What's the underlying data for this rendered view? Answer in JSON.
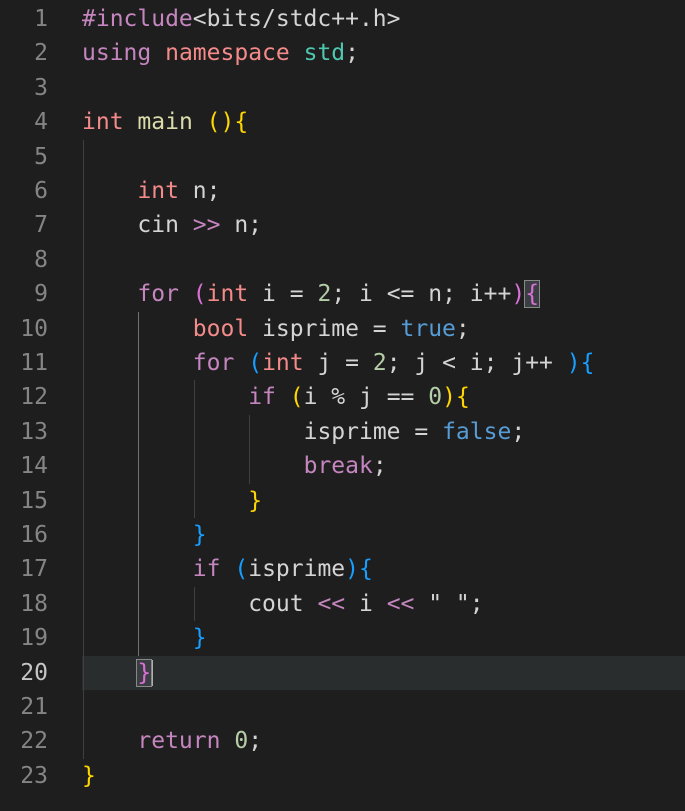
{
  "editor": {
    "current_line": 20,
    "lines": [
      {
        "n": "1",
        "indent": 0,
        "tokens": [
          [
            "t-inc",
            "#include"
          ],
          [
            "t-hdr",
            "<bits/stdc++.h>"
          ]
        ]
      },
      {
        "n": "2",
        "indent": 0,
        "tokens": [
          [
            "t-kw",
            "using"
          ],
          [
            "t-plain",
            " "
          ],
          [
            "t-type",
            "namespace"
          ],
          [
            "t-plain",
            " "
          ],
          [
            "t-ns",
            "std"
          ],
          [
            "t-plain",
            ";"
          ]
        ]
      },
      {
        "n": "3",
        "indent": 0,
        "tokens": []
      },
      {
        "n": "4",
        "indent": 0,
        "tokens": [
          [
            "t-type",
            "int"
          ],
          [
            "t-plain",
            " "
          ],
          [
            "t-fn",
            "main"
          ],
          [
            "t-plain",
            " "
          ],
          [
            "t-b1",
            "()"
          ],
          [
            "t-b1",
            "{"
          ]
        ]
      },
      {
        "n": "5",
        "indent": 0,
        "tokens": []
      },
      {
        "n": "6",
        "indent": 1,
        "tokens": [
          [
            "t-type",
            "int"
          ],
          [
            "t-plain",
            " n;"
          ]
        ]
      },
      {
        "n": "7",
        "indent": 1,
        "tokens": [
          [
            "t-plain",
            "cin "
          ],
          [
            "t-kw",
            ">>"
          ],
          [
            "t-plain",
            " n;"
          ]
        ]
      },
      {
        "n": "8",
        "indent": 0,
        "tokens": []
      },
      {
        "n": "9",
        "indent": 1,
        "tokens": [
          [
            "t-kw",
            "for"
          ],
          [
            "t-plain",
            " "
          ],
          [
            "t-b2",
            "("
          ],
          [
            "t-type",
            "int"
          ],
          [
            "t-plain",
            " i = "
          ],
          [
            "t-num",
            "2"
          ],
          [
            "t-plain",
            "; i <= n; i++"
          ],
          [
            "t-b2",
            ")"
          ],
          [
            "t-b2-match",
            "{"
          ]
        ]
      },
      {
        "n": "10",
        "indent": 2,
        "tokens": [
          [
            "t-type",
            "bool"
          ],
          [
            "t-plain",
            " isprime = "
          ],
          [
            "t-bool",
            "true"
          ],
          [
            "t-plain",
            ";"
          ]
        ]
      },
      {
        "n": "11",
        "indent": 2,
        "tokens": [
          [
            "t-kw",
            "for"
          ],
          [
            "t-plain",
            " "
          ],
          [
            "t-b3",
            "("
          ],
          [
            "t-type",
            "int"
          ],
          [
            "t-plain",
            " j = "
          ],
          [
            "t-num",
            "2"
          ],
          [
            "t-plain",
            "; j < i; j++ "
          ],
          [
            "t-b3",
            ")"
          ],
          [
            "t-b3",
            "{"
          ]
        ]
      },
      {
        "n": "12",
        "indent": 3,
        "tokens": [
          [
            "t-kw",
            "if"
          ],
          [
            "t-plain",
            " "
          ],
          [
            "t-b1",
            "("
          ],
          [
            "t-plain",
            "i % j == "
          ],
          [
            "t-num",
            "0"
          ],
          [
            "t-b1",
            ")"
          ],
          [
            "t-b1",
            "{"
          ]
        ]
      },
      {
        "n": "13",
        "indent": 4,
        "tokens": [
          [
            "t-plain",
            "isprime = "
          ],
          [
            "t-bool",
            "false"
          ],
          [
            "t-plain",
            ";"
          ]
        ]
      },
      {
        "n": "14",
        "indent": 4,
        "tokens": [
          [
            "t-kw",
            "break"
          ],
          [
            "t-plain",
            ";"
          ]
        ]
      },
      {
        "n": "15",
        "indent": 3,
        "tokens": [
          [
            "t-b1",
            "}"
          ]
        ]
      },
      {
        "n": "16",
        "indent": 2,
        "tokens": [
          [
            "t-b3",
            "}"
          ]
        ]
      },
      {
        "n": "17",
        "indent": 2,
        "tokens": [
          [
            "t-kw",
            "if"
          ],
          [
            "t-plain",
            " "
          ],
          [
            "t-b3",
            "("
          ],
          [
            "t-plain",
            "isprime"
          ],
          [
            "t-b3",
            ")"
          ],
          [
            "t-b3",
            "{"
          ]
        ]
      },
      {
        "n": "18",
        "indent": 3,
        "tokens": [
          [
            "t-plain",
            "cout "
          ],
          [
            "t-kw",
            "<<"
          ],
          [
            "t-plain",
            " i "
          ],
          [
            "t-kw",
            "<<"
          ],
          [
            "t-plain",
            " \" \";"
          ]
        ]
      },
      {
        "n": "19",
        "indent": 2,
        "tokens": [
          [
            "t-b3",
            "}"
          ]
        ]
      },
      {
        "n": "20",
        "indent": 1,
        "tokens": [
          [
            "t-b2-match",
            "}"
          ],
          [
            "cursor",
            ""
          ]
        ]
      },
      {
        "n": "21",
        "indent": 0,
        "tokens": []
      },
      {
        "n": "22",
        "indent": 1,
        "tokens": [
          [
            "t-kw",
            "return"
          ],
          [
            "t-plain",
            " "
          ],
          [
            "t-num",
            "0"
          ],
          [
            "t-plain",
            ";"
          ]
        ]
      },
      {
        "n": "23",
        "indent": 0,
        "tokens": [
          [
            "t-b1",
            "}"
          ]
        ]
      }
    ],
    "guides": [
      {
        "from": 5,
        "to": 22,
        "level": 0
      },
      {
        "from": 10,
        "to": 19,
        "level": 1,
        "active": true
      },
      {
        "from": 12,
        "to": 15,
        "level": 2
      },
      {
        "from": 13,
        "to": 14,
        "level": 3
      },
      {
        "from": 18,
        "to": 18,
        "level": 2
      }
    ],
    "colors": {
      "background": "#1e1e1e",
      "current_line": "#2a2d2e",
      "line_number": "#858585",
      "keyword": "#c586c0",
      "type": "#f48a8a",
      "namespace": "#4ec9b0",
      "function": "#dcdcaa",
      "number": "#b5cea8",
      "bool": "#569cd6",
      "bracket_1": "#ffd700",
      "bracket_2": "#da70d6",
      "bracket_3": "#179fff"
    }
  }
}
